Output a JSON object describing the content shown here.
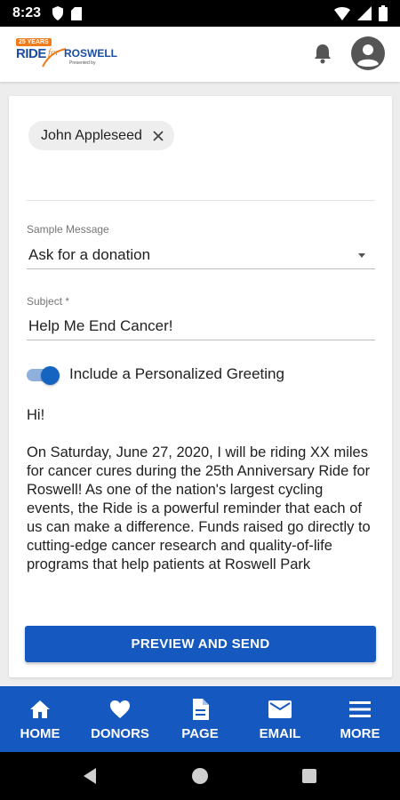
{
  "status_bar": {
    "time": "8:23"
  },
  "logo": {
    "badge": "25 YEARS",
    "ride": "RIDE",
    "for": "for",
    "roswell": "ROSWELL",
    "presented": "Presented by"
  },
  "recipient_chip": {
    "name": "John Appleseed"
  },
  "sample_message": {
    "label": "Sample Message",
    "value": "Ask for a donation"
  },
  "subject": {
    "label": "Subject *",
    "value": "Help Me End Cancer!"
  },
  "greeting_toggle": {
    "label": "Include a Personalized Greeting",
    "on": true
  },
  "message": {
    "greeting": "Hi!",
    "body": "On Saturday, June 27, 2020, I will be riding XX miles for cancer cures during the 25th Anniversary Ride for Roswell! As one of the nation's largest cycling events, the Ride is a powerful reminder that each of us can make a difference. Funds raised go directly to cutting-edge cancer research and quality-of-life programs that help patients at Roswell Park"
  },
  "preview_button": {
    "label": "PREVIEW AND SEND"
  },
  "bottom_nav": [
    {
      "label": "HOME",
      "icon": "home-icon"
    },
    {
      "label": "DONORS",
      "icon": "heart-icon"
    },
    {
      "label": "PAGE",
      "icon": "document-icon"
    },
    {
      "label": "EMAIL",
      "icon": "email-icon"
    },
    {
      "label": "MORE",
      "icon": "menu-icon"
    }
  ],
  "colors": {
    "primary": "#1558c0",
    "accent": "#f07b1b"
  }
}
